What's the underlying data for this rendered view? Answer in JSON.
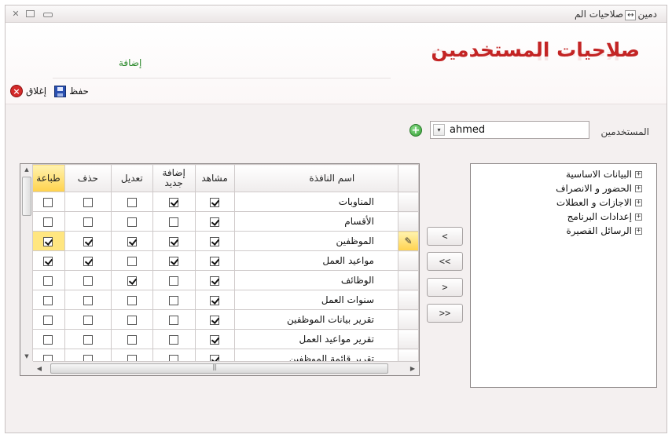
{
  "window": {
    "title_part1": "صلاحيات الم",
    "title_resize_glyph": "↔",
    "title_part2": "دمين",
    "controls": {
      "close": "✕",
      "max": "□",
      "min": "—"
    }
  },
  "header": {
    "title": "صلاحيات المستخدمين",
    "section_label": "إضافة"
  },
  "toolbar": {
    "save_label": "حفظ",
    "close_label": "إغلاق"
  },
  "user": {
    "label": "المستخدمين",
    "selected": "ahmed",
    "dropdown_glyph": "▾",
    "add_glyph": "+"
  },
  "grid": {
    "columns": [
      "اسم النافذة",
      "مشاهد",
      "إضافة جديد",
      "تعديل",
      "حذف",
      "طباعة"
    ],
    "rows": [
      {
        "name": "المناوبات",
        "view": true,
        "add": true,
        "edit": false,
        "del": false,
        "print": false
      },
      {
        "name": "الأقسام",
        "view": true,
        "add": false,
        "edit": false,
        "del": false,
        "print": false
      },
      {
        "name": "الموظفين",
        "view": true,
        "add": true,
        "edit": true,
        "del": true,
        "print": true,
        "current": true
      },
      {
        "name": "مواعيد العمل",
        "view": true,
        "add": true,
        "edit": false,
        "del": true,
        "print": true
      },
      {
        "name": "الوظائف",
        "view": true,
        "add": false,
        "edit": true,
        "del": false,
        "print": false
      },
      {
        "name": "سنوات العمل",
        "view": true,
        "add": false,
        "edit": false,
        "del": false,
        "print": false
      },
      {
        "name": "تقرير بيانات الموظفين",
        "view": true,
        "add": false,
        "edit": false,
        "del": false,
        "print": false
      },
      {
        "name": "تقرير مواعيد العمل",
        "view": true,
        "add": false,
        "edit": false,
        "del": false,
        "print": false
      },
      {
        "name": "تقرير قائمة الموظفين",
        "view": true,
        "add": false,
        "edit": false,
        "del": false,
        "print": false
      }
    ]
  },
  "transfer_buttons": [
    "<",
    "<<",
    ">",
    ">>"
  ],
  "tree": {
    "items": [
      "البيانات الاساسية",
      "الحضور و الانصراف",
      "الاجازات و العطلات",
      "إعدادات البرنامج",
      "الرسائل القصيرة"
    ],
    "expand_glyph": "+"
  }
}
